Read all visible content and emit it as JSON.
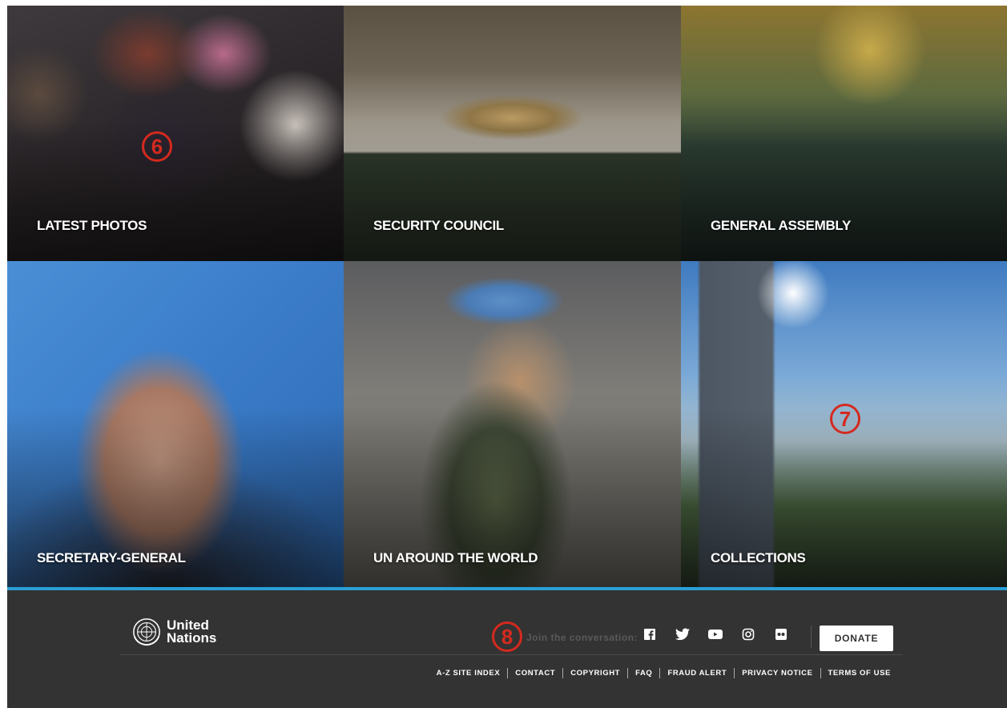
{
  "tiles": [
    {
      "label": "LATEST PHOTOS"
    },
    {
      "label": "SECURITY COUNCIL"
    },
    {
      "label": "GENERAL ASSEMBLY"
    },
    {
      "label": "SECRETARY-GENERAL"
    },
    {
      "label": "UN AROUND THE WORLD"
    },
    {
      "label": "COLLECTIONS"
    }
  ],
  "markers": {
    "m6": "6",
    "m7": "7",
    "m8": "8"
  },
  "footer": {
    "logo_line1": "United",
    "logo_line2": "Nations",
    "join_text": "Join the conversation:",
    "socials": [
      "facebook-icon",
      "twitter-icon",
      "youtube-icon",
      "instagram-icon",
      "flickr-icon"
    ],
    "donate_label": "DONATE",
    "links": [
      "A-Z SITE INDEX",
      "CONTACT",
      "COPYRIGHT",
      "FAQ",
      "FRAUD ALERT",
      "PRIVACY NOTICE",
      "TERMS OF USE"
    ]
  },
  "colors": {
    "footer_bg": "#333333",
    "accent": "#2a9fd6",
    "marker": "#d42a1e"
  }
}
